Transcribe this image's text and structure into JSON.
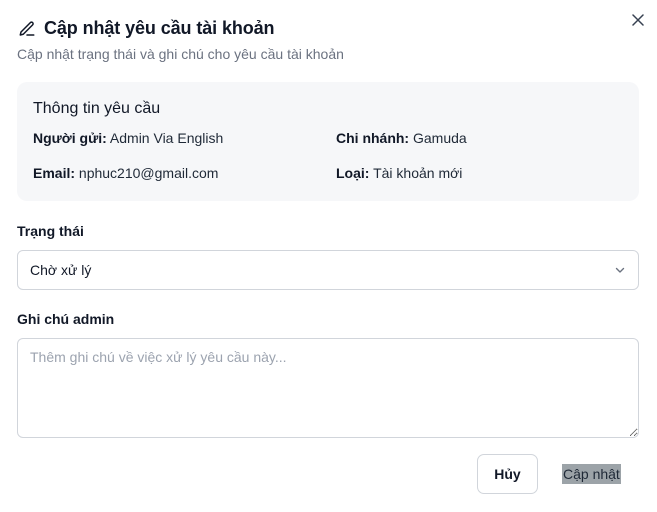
{
  "dialog": {
    "title": "Cập nhật yêu cầu tài khoản",
    "subtitle": "Cập nhật trạng thái và ghi chú cho yêu cầu tài khoản",
    "title_icon": "pencil-icon",
    "close_icon": "close-icon"
  },
  "info": {
    "heading": "Thông tin yêu cầu",
    "sender_label": "Người gửi:",
    "sender_value": "Admin Via English",
    "branch_label": "Chi nhánh:",
    "branch_value": "Gamuda",
    "email_label": "Email:",
    "email_value": "nphuc210@gmail.com",
    "type_label": "Loại:",
    "type_value": "Tài khoản mới"
  },
  "status": {
    "label": "Trạng thái",
    "selected": "Chờ xử lý",
    "icon": "chevron-down-icon"
  },
  "note": {
    "label": "Ghi chú admin",
    "placeholder": "Thêm ghi chú về việc xử lý yêu cầu này...",
    "value": ""
  },
  "actions": {
    "cancel_label": "Hủy",
    "update_label": "Cập nhật"
  }
}
